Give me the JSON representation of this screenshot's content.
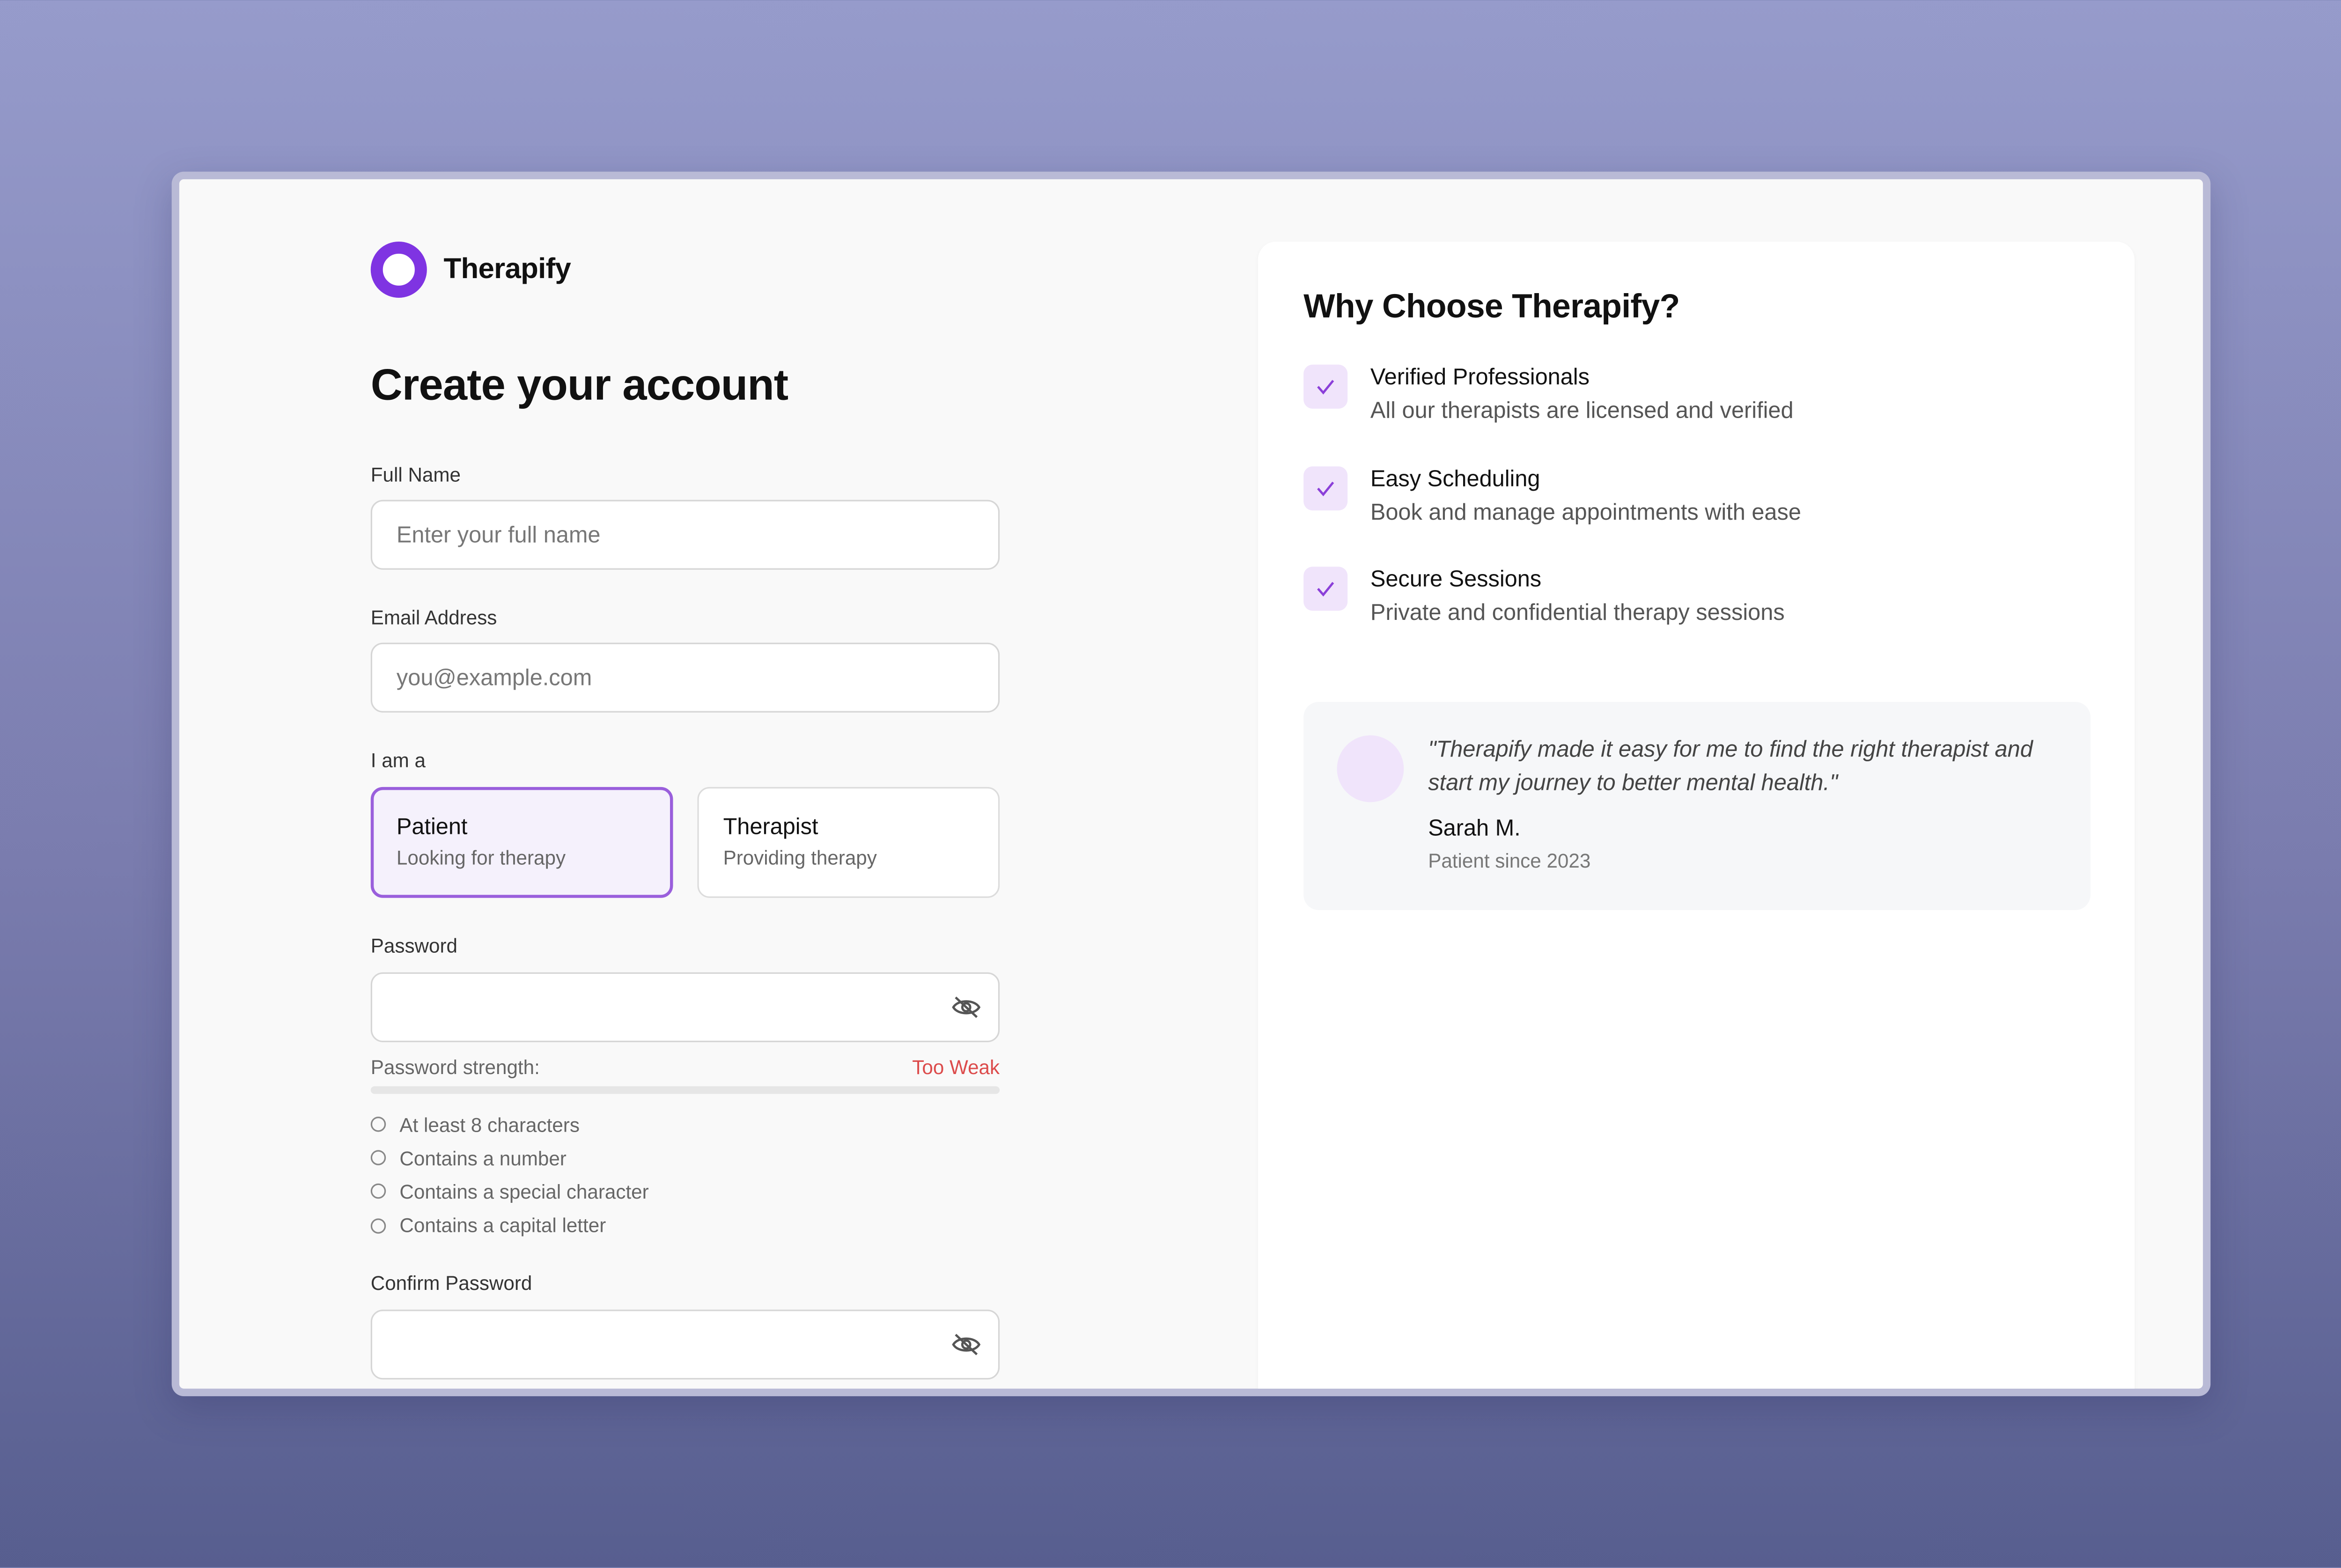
{
  "brand": {
    "name": "Therapify"
  },
  "form": {
    "title": "Create your account",
    "full_name": {
      "label": "Full Name",
      "placeholder": "Enter your full name",
      "value": ""
    },
    "email": {
      "label": "Email Address",
      "placeholder": "you@example.com",
      "value": ""
    },
    "role": {
      "label": "I am a",
      "selected": "patient",
      "options": [
        {
          "title": "Patient",
          "subtitle": "Looking for therapy"
        },
        {
          "title": "Therapist",
          "subtitle": "Providing therapy"
        }
      ]
    },
    "password": {
      "label": "Password",
      "value": "",
      "strength_label": "Password strength:",
      "strength_status": "Too Weak",
      "strength_fraction": 0,
      "requirements": [
        "At least 8 characters",
        "Contains a number",
        "Contains a special character",
        "Contains a capital letter"
      ]
    },
    "confirm_password": {
      "label": "Confirm Password",
      "value": ""
    }
  },
  "panel": {
    "title": "Why Choose Therapify?",
    "features": [
      {
        "title": "Verified Professionals",
        "description": "All our therapists are licensed and verified"
      },
      {
        "title": "Easy Scheduling",
        "description": "Book and manage appointments with ease"
      },
      {
        "title": "Secure Sessions",
        "description": "Private and confidential therapy sessions"
      }
    ],
    "testimonial": {
      "quote": "\"Therapify made it easy for me to find the right therapist and start my journey to better mental health.\"",
      "author": "Sarah M.",
      "meta": "Patient since 2023"
    }
  },
  "colors": {
    "accent": "#7f34e2",
    "danger": "#dc4b4b",
    "check_bg": "#f0e4fb"
  },
  "icons": {
    "password_toggle": "eye-off-icon",
    "feature_check": "check-icon",
    "requirement": "circle-icon"
  }
}
